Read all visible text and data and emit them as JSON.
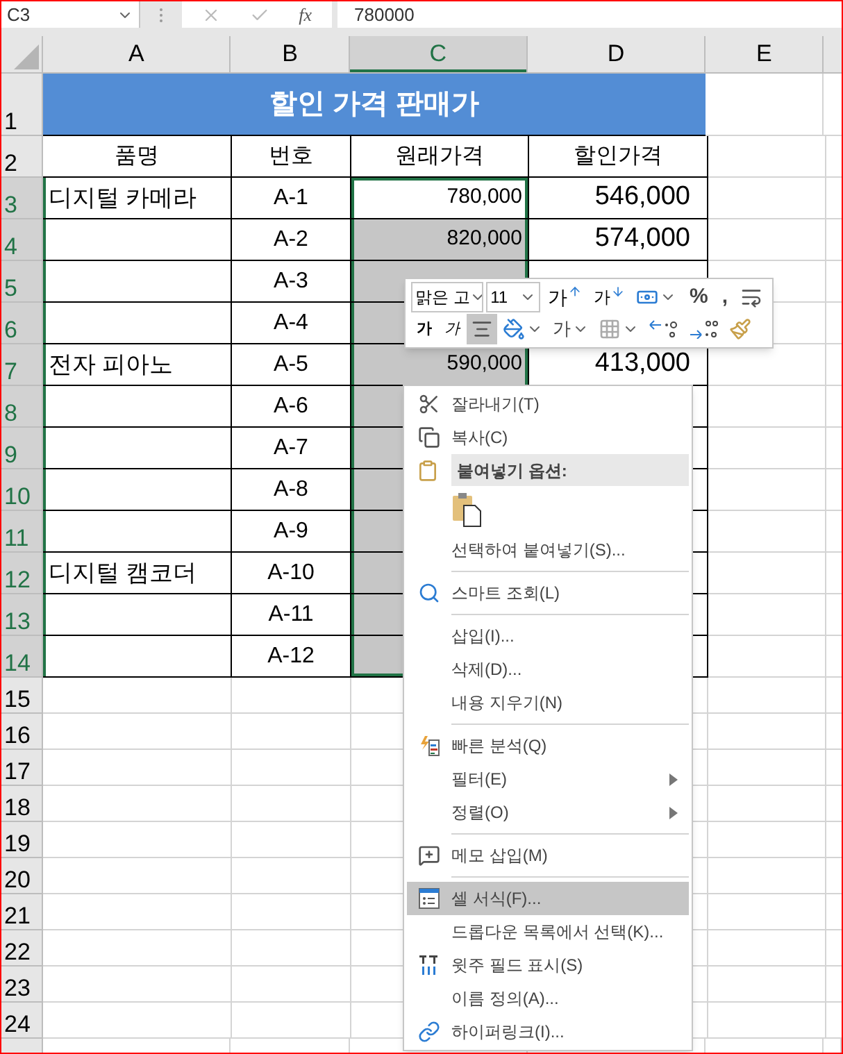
{
  "formula_bar": {
    "name_box": "C3",
    "function_label": "fx",
    "formula": "780000"
  },
  "columns": [
    {
      "label": "A",
      "selected": false
    },
    {
      "label": "B",
      "selected": false
    },
    {
      "label": "C",
      "selected": true
    },
    {
      "label": "D",
      "selected": false
    },
    {
      "label": "E",
      "selected": false
    }
  ],
  "rows": [
    {
      "label": "1",
      "kind": "title",
      "selected": false,
      "title": "할인 가격 판매가"
    },
    {
      "label": "2",
      "kind": "header",
      "selected": false,
      "product": "품명",
      "code": "번호",
      "original_price": "원래가격",
      "discount_price": "할인가격"
    },
    {
      "label": "3",
      "kind": "data",
      "selected": true,
      "product": "디지털 카메라",
      "code": "A-1",
      "original_price": "780,000",
      "discount_price": "546,000"
    },
    {
      "label": "4",
      "kind": "data",
      "selected": true,
      "code": "A-2",
      "original_price": "820,000",
      "discount_price": "574,000"
    },
    {
      "label": "5",
      "kind": "data",
      "selected": true,
      "code": "A-3"
    },
    {
      "label": "6",
      "kind": "data",
      "selected": true,
      "code": "A-4"
    },
    {
      "label": "7",
      "kind": "data",
      "selected": true,
      "product": "전자 피아노",
      "code": "A-5",
      "original_price": "590,000",
      "discount_price": "413,000"
    },
    {
      "label": "8",
      "kind": "data",
      "selected": true,
      "code": "A-6"
    },
    {
      "label": "9",
      "kind": "data",
      "selected": true,
      "code": "A-7"
    },
    {
      "label": "10",
      "kind": "data",
      "selected": true,
      "code": "A-8"
    },
    {
      "label": "11",
      "kind": "data",
      "selected": true,
      "code": "A-9"
    },
    {
      "label": "12",
      "kind": "data",
      "selected": true,
      "product": "디지털 캠코더",
      "code": "A-10"
    },
    {
      "label": "13",
      "kind": "data",
      "selected": true,
      "code": "A-11"
    },
    {
      "label": "14",
      "kind": "data",
      "selected": true,
      "code": "A-12"
    },
    {
      "label": "15",
      "kind": "empty",
      "selected": false
    },
    {
      "label": "16",
      "kind": "empty",
      "selected": false
    },
    {
      "label": "17",
      "kind": "empty",
      "selected": false
    },
    {
      "label": "18",
      "kind": "empty",
      "selected": false
    },
    {
      "label": "19",
      "kind": "empty",
      "selected": false
    },
    {
      "label": "20",
      "kind": "empty",
      "selected": false
    },
    {
      "label": "21",
      "kind": "empty",
      "selected": false
    },
    {
      "label": "22",
      "kind": "empty",
      "selected": false
    },
    {
      "label": "23",
      "kind": "empty",
      "selected": false
    },
    {
      "label": "24",
      "kind": "empty",
      "selected": false
    }
  ],
  "mini_toolbar": {
    "font_name": "맑은 고",
    "font_size": "11",
    "row1": [
      {
        "kind": "grow_font",
        "label": "가"
      },
      {
        "kind": "shrink_font",
        "label": "가"
      },
      {
        "kind": "accounting"
      },
      {
        "kind": "percent",
        "label": "%"
      },
      {
        "kind": "comma",
        "label": ","
      },
      {
        "kind": "wrap"
      }
    ],
    "row2": [
      {
        "kind": "bold",
        "label": "가",
        "selected": false
      },
      {
        "kind": "italic",
        "label": "가",
        "selected": false
      },
      {
        "kind": "center",
        "selected": true
      },
      {
        "kind": "fill_color",
        "selected": false
      },
      {
        "kind": "font_color",
        "label": "가",
        "selected": false
      },
      {
        "kind": "borders",
        "selected": false
      },
      {
        "kind": "increase_decimal",
        "selected": false
      },
      {
        "kind": "decrease_decimal",
        "selected": false
      },
      {
        "kind": "painter",
        "selected": false
      }
    ]
  },
  "context_menu": [
    {
      "kind": "cut",
      "label": "잘라내기(T)",
      "selected": false,
      "submenu": false
    },
    {
      "kind": "copy",
      "label": "복사(C)",
      "selected": false,
      "submenu": false
    },
    {
      "kind": "header",
      "label": "붙여넣기 옵션:"
    },
    {
      "kind": "paste_options"
    },
    {
      "kind": "item",
      "label": "선택하여 붙여넣기(S)...",
      "selected": false,
      "submenu": false
    },
    {
      "kind": "separator"
    },
    {
      "kind": "lookup",
      "label": "스마트 조회(L)",
      "selected": false,
      "submenu": false
    },
    {
      "kind": "separator"
    },
    {
      "kind": "item",
      "label": "삽입(I)...",
      "selected": false,
      "submenu": false
    },
    {
      "kind": "item",
      "label": "삭제(D)...",
      "selected": false,
      "submenu": false
    },
    {
      "kind": "item",
      "label": "내용 지우기(N)",
      "selected": false,
      "submenu": false
    },
    {
      "kind": "separator"
    },
    {
      "kind": "analysis",
      "label": "빠른 분석(Q)",
      "selected": false,
      "submenu": false
    },
    {
      "kind": "item",
      "label": "필터(E)",
      "selected": false,
      "submenu": true
    },
    {
      "kind": "item",
      "label": "정렬(O)",
      "selected": false,
      "submenu": true
    },
    {
      "kind": "separator"
    },
    {
      "kind": "comment",
      "label": "메모 삽입(M)",
      "selected": false,
      "submenu": false
    },
    {
      "kind": "separator"
    },
    {
      "kind": "format",
      "label": "셀 서식(F)...",
      "selected": true,
      "submenu": false
    },
    {
      "kind": "item",
      "label": "드롭다운 목록에서 선택(K)...",
      "selected": false,
      "submenu": false
    },
    {
      "kind": "phonetic",
      "label": "윗주 필드 표시(S)",
      "selected": false,
      "submenu": false
    },
    {
      "kind": "item",
      "label": "이름 정의(A)...",
      "selected": false,
      "submenu": false
    },
    {
      "kind": "link",
      "label": "하이퍼링크(I)...",
      "selected": false,
      "submenu": false
    }
  ]
}
